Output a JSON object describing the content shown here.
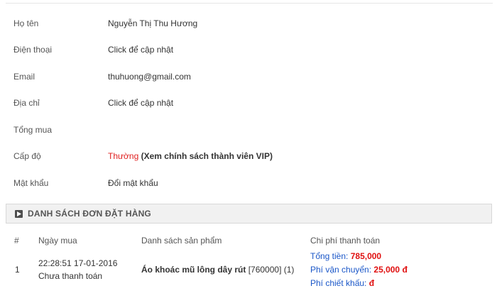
{
  "profile": {
    "name": {
      "label": "Họ tên",
      "value": "Nguyễn Thị Thu Hương"
    },
    "phone": {
      "label": "Điện thoại",
      "value": "Click để cập nhật"
    },
    "email": {
      "label": "Email",
      "value": "thuhuong@gmail.com"
    },
    "address": {
      "label": "Địa chỉ",
      "value": "Click để cập nhật"
    },
    "total_purchase": {
      "label": "Tổng mua",
      "value": ""
    },
    "level": {
      "label": "Cấp độ",
      "value": "Thường",
      "link": "(Xem chính sách thành viên VIP)"
    },
    "password": {
      "label": "Mật khẩu",
      "value": "Đổi mật khẩu"
    }
  },
  "orders": {
    "title": "DANH SÁCH ĐƠN ĐẶT HÀNG",
    "columns": {
      "index": "#",
      "date": "Ngày mua",
      "products": "Danh sách sản phẩm",
      "payment": "Chi phí thanh toán"
    },
    "rows": [
      {
        "index": "1",
        "datetime": "22:28:51 17-01-2016",
        "status": "Chưa thanh toán",
        "product_name": "Áo khoác mũ lông dây rút",
        "product_detail": " [760000] (1)",
        "total_label": "Tổng tiền:",
        "total_value": "785,000",
        "shipping_label": "Phí vận chuyển:",
        "shipping_value": "25,000 đ",
        "discount_label": "Phí chiết khấu:",
        "discount_value": "đ"
      }
    ]
  },
  "colors": {
    "accent_red": "#e01010",
    "link_green": "#2a8a2a",
    "label_blue": "#1b57c8"
  },
  "icons": {
    "section": "arrow-right-box-icon"
  }
}
